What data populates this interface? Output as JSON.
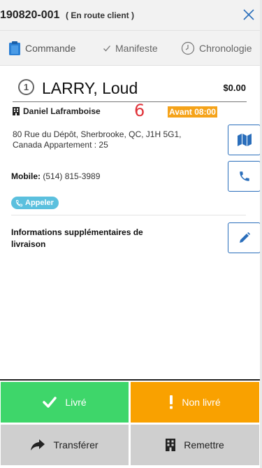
{
  "header": {
    "order_id": "190820-001",
    "status": "( En route client )",
    "close_icon": "close-icon"
  },
  "tabs": [
    {
      "label": "Commande",
      "icon": "clipboard-icon",
      "active": true
    },
    {
      "label": "Manifeste",
      "icon": "check-icon",
      "active": false
    },
    {
      "label": "Chronologie",
      "icon": "clock-icon",
      "active": false
    }
  ],
  "stop": {
    "sequence": "1",
    "client_name": "LARRY, Loud",
    "amount": "$0.00",
    "contact_name": "Daniel Laframboise",
    "stop_number": "6",
    "time_window": "Avant 08:00",
    "address": "80 Rue du Dépôt, Sherbrooke, QC, J1H 5G1, Canada Appartement : 25",
    "mobile_label": "Mobile:",
    "mobile_value": "(514) 815-3989",
    "call_label": "Appeler",
    "extra_info_label": "Informations supplémentaires de livraison"
  },
  "actions": {
    "delivered": "Livré",
    "not_delivered": "Non livré",
    "transfer": "Transférer",
    "handover": "Remettre"
  },
  "colors": {
    "accent": "#2a6ebb",
    "delivered": "#3ed66a",
    "not_delivered": "#f9a100",
    "secondary": "#cfcfcf",
    "time_badge": "#f5a31a",
    "stop_number": "#e0333a",
    "call_pill": "#5bc0de"
  }
}
